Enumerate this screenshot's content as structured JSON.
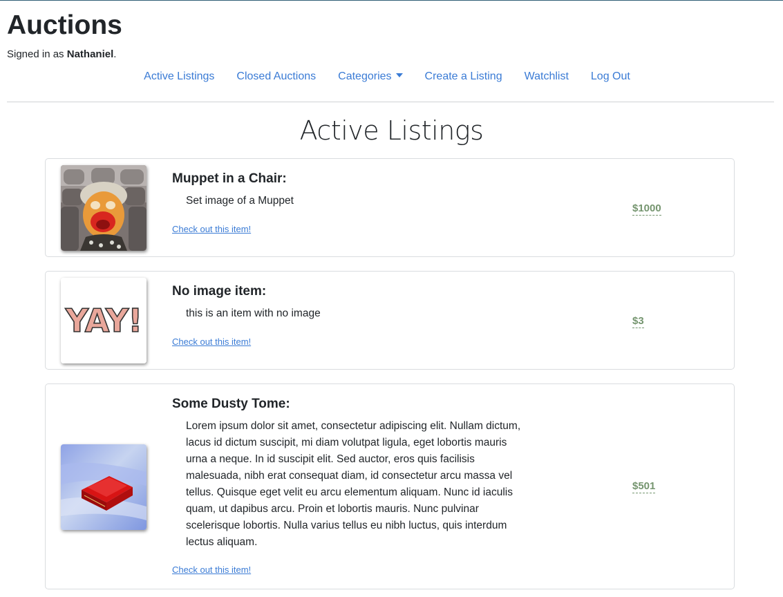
{
  "site": {
    "title": "Auctions",
    "signed_in_prefix": "Signed in as ",
    "username": "Nathaniel",
    "signed_in_suffix": "."
  },
  "nav": {
    "active_listings": "Active Listings",
    "closed_auctions": "Closed Auctions",
    "categories": "Categories",
    "create_listing": "Create a Listing",
    "watchlist": "Watchlist",
    "log_out": "Log Out"
  },
  "page": {
    "title": "Active Listings"
  },
  "listings": [
    {
      "name": "Muppet in a Chair:",
      "description": "Set image of a Muppet",
      "link": "Check out this item!",
      "price": "$1000",
      "image": "muppet-in-theater-seats"
    },
    {
      "name": "No image item:",
      "description": "this is an item with no image",
      "link": "Check out this item!",
      "price": "$3",
      "image": "yay-placeholder",
      "image_text": "YAY!"
    },
    {
      "name": "Some Dusty Tome:",
      "description": "Lorem ipsum dolor sit amet, consectetur adipiscing elit. Nullam dictum, lacus id dictum suscipit, mi diam volutpat ligula, eget lobortis mauris urna a neque. In id suscipit elit. Sed auctor, eros quis facilisis malesuada, nibh erat consequat diam, id consectetur arcu massa vel tellus. Quisque eget velit eu arcu elementum aliquam. Nunc id iaculis quam, ut dapibus arcu. Proin et lobortis mauris. Nunc pulvinar scelerisque lobortis. Nulla varius tellus eu nibh luctus, quis interdum lectus aliquam.",
      "link": "Check out this item!",
      "price": "$501",
      "image": "red-book-on-blue"
    }
  ],
  "colors": {
    "link": "#3a7bd5",
    "price": "#75956f",
    "border": "#d9dcdf"
  }
}
